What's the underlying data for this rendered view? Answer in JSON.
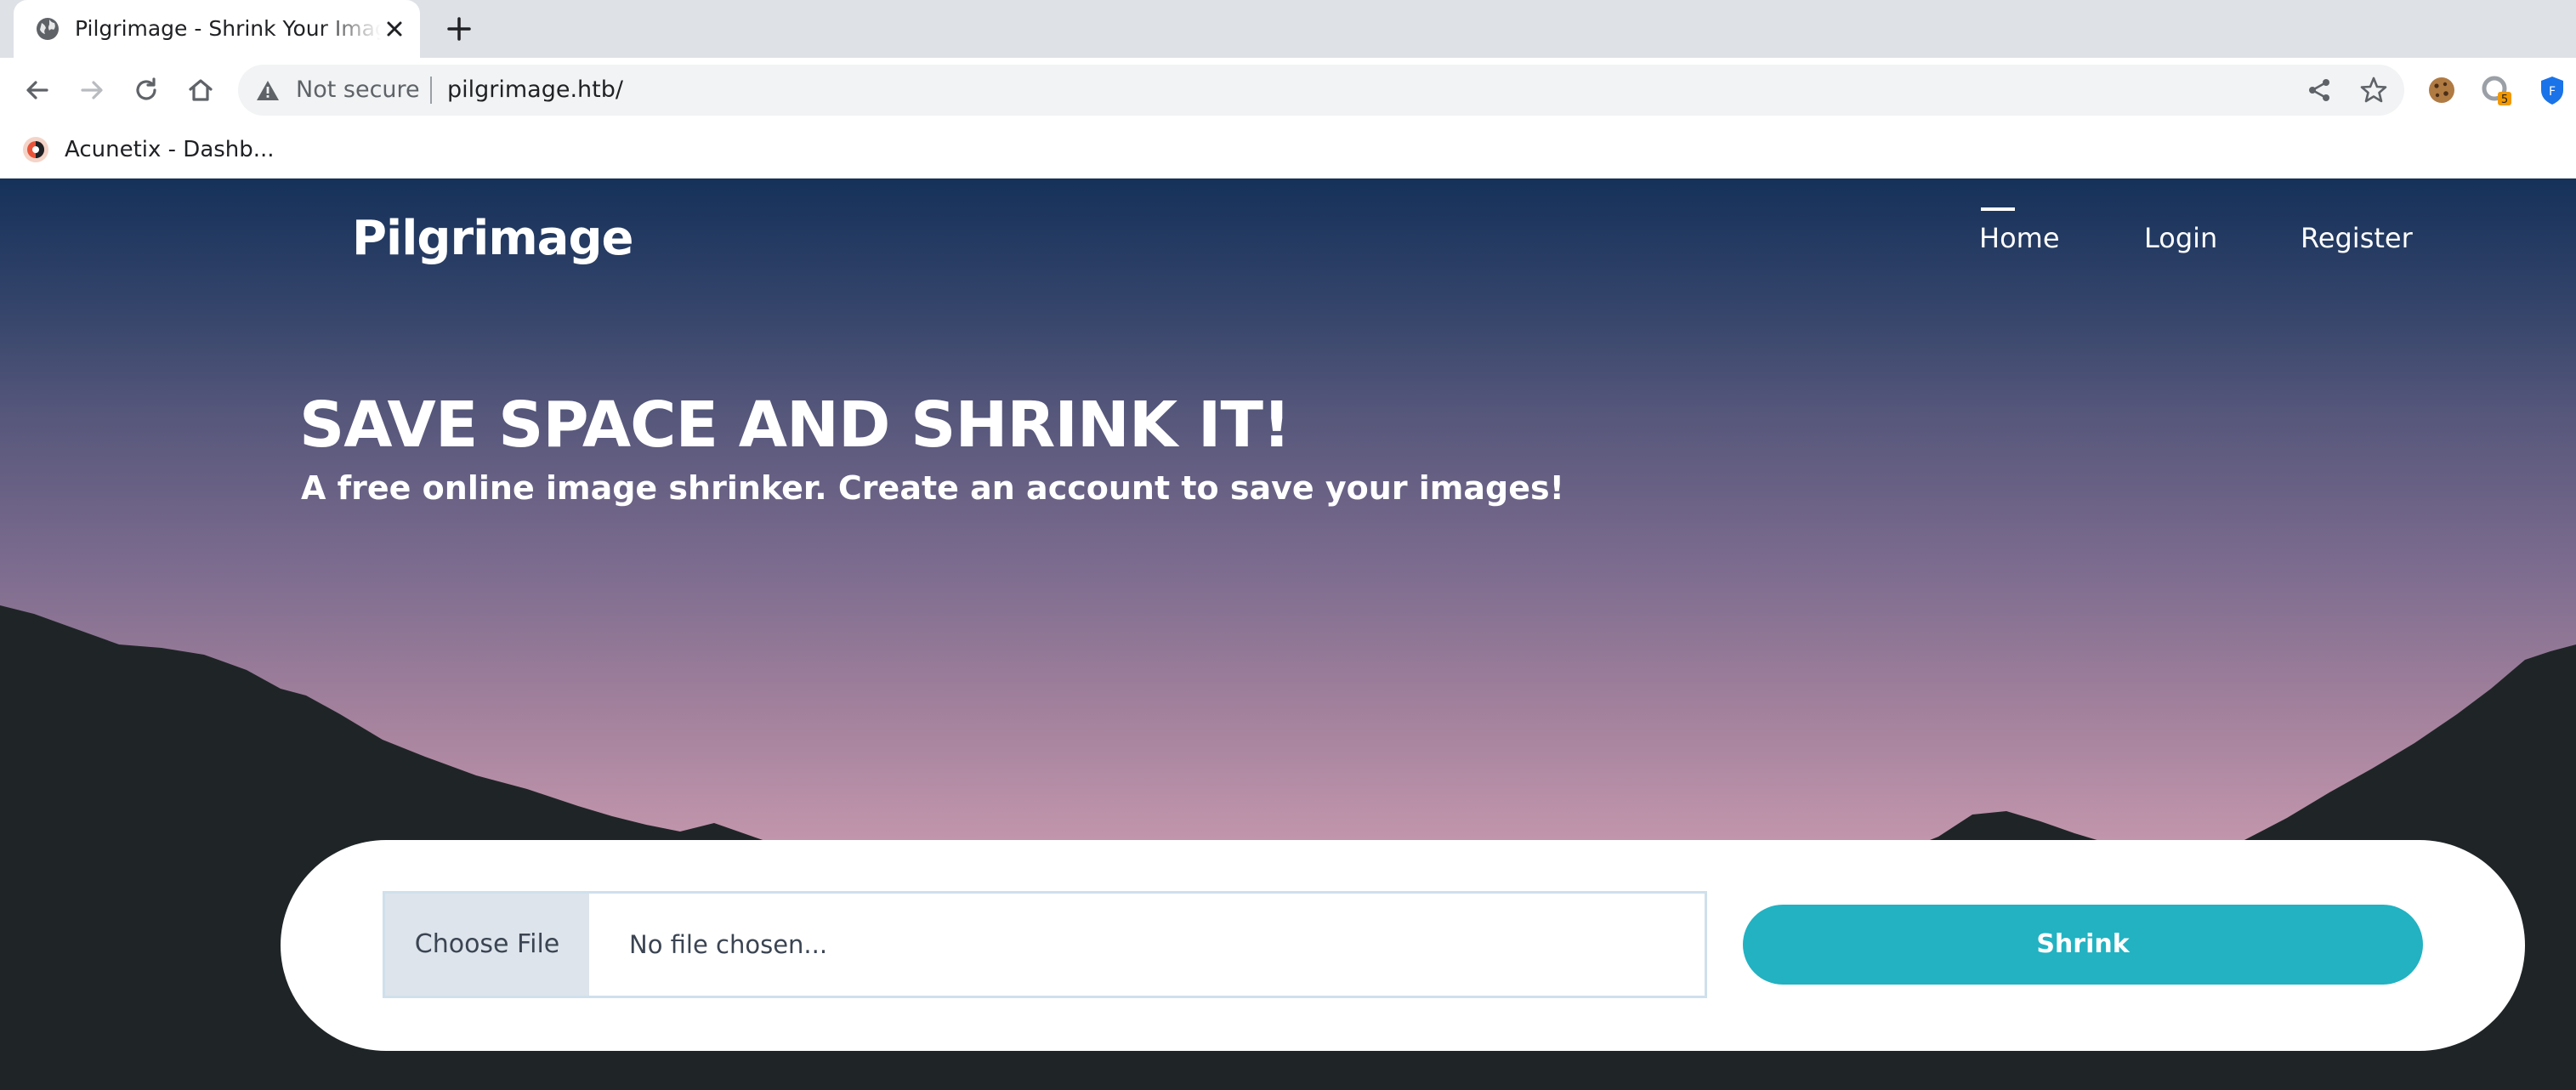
{
  "browser": {
    "tab_title": "Pilgrimage - Shrink Your Images",
    "security_label": "Not secure",
    "url": "pilgrimage.htb/",
    "bookmark_label": "Acunetix - Dashb...",
    "extension_badge": "5",
    "profile_initial": "F"
  },
  "site": {
    "brand": "Pilgrimage",
    "nav": {
      "home": "Home",
      "login": "Login",
      "register": "Register"
    },
    "active_nav": "Home"
  },
  "hero": {
    "title": "SAVE SPACE AND SHRINK IT!",
    "subtitle": "A free online image shrinker. Create an account to save your images!"
  },
  "upload": {
    "choose_file_label": "Choose File",
    "file_status": "No file chosen...",
    "submit_label": "Shrink"
  },
  "colors": {
    "accent": "#22b2c2",
    "mountains": "#1f2527",
    "sky_top": "#15315a",
    "sky_bottom": "#d7a5b9"
  }
}
